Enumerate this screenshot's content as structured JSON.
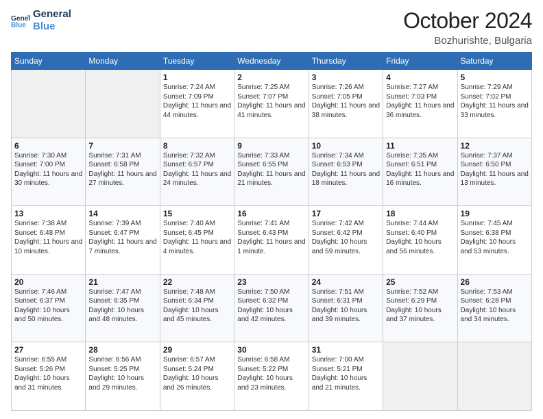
{
  "header": {
    "logo_line1": "General",
    "logo_line2": "Blue",
    "month": "October 2024",
    "location": "Bozhurishte, Bulgaria"
  },
  "weekdays": [
    "Sunday",
    "Monday",
    "Tuesday",
    "Wednesday",
    "Thursday",
    "Friday",
    "Saturday"
  ],
  "weeks": [
    [
      {
        "day": "",
        "empty": true
      },
      {
        "day": "",
        "empty": true
      },
      {
        "day": "1",
        "sunrise": "7:24 AM",
        "sunset": "7:09 PM",
        "daylight": "11 hours and 44 minutes."
      },
      {
        "day": "2",
        "sunrise": "7:25 AM",
        "sunset": "7:07 PM",
        "daylight": "11 hours and 41 minutes."
      },
      {
        "day": "3",
        "sunrise": "7:26 AM",
        "sunset": "7:05 PM",
        "daylight": "11 hours and 38 minutes."
      },
      {
        "day": "4",
        "sunrise": "7:27 AM",
        "sunset": "7:03 PM",
        "daylight": "11 hours and 36 minutes."
      },
      {
        "day": "5",
        "sunrise": "7:29 AM",
        "sunset": "7:02 PM",
        "daylight": "11 hours and 33 minutes."
      }
    ],
    [
      {
        "day": "6",
        "sunrise": "7:30 AM",
        "sunset": "7:00 PM",
        "daylight": "11 hours and 30 minutes."
      },
      {
        "day": "7",
        "sunrise": "7:31 AM",
        "sunset": "6:58 PM",
        "daylight": "11 hours and 27 minutes."
      },
      {
        "day": "8",
        "sunrise": "7:32 AM",
        "sunset": "6:57 PM",
        "daylight": "11 hours and 24 minutes."
      },
      {
        "day": "9",
        "sunrise": "7:33 AM",
        "sunset": "6:55 PM",
        "daylight": "11 hours and 21 minutes."
      },
      {
        "day": "10",
        "sunrise": "7:34 AM",
        "sunset": "6:53 PM",
        "daylight": "11 hours and 18 minutes."
      },
      {
        "day": "11",
        "sunrise": "7:35 AM",
        "sunset": "6:51 PM",
        "daylight": "11 hours and 16 minutes."
      },
      {
        "day": "12",
        "sunrise": "7:37 AM",
        "sunset": "6:50 PM",
        "daylight": "11 hours and 13 minutes."
      }
    ],
    [
      {
        "day": "13",
        "sunrise": "7:38 AM",
        "sunset": "6:48 PM",
        "daylight": "11 hours and 10 minutes."
      },
      {
        "day": "14",
        "sunrise": "7:39 AM",
        "sunset": "6:47 PM",
        "daylight": "11 hours and 7 minutes."
      },
      {
        "day": "15",
        "sunrise": "7:40 AM",
        "sunset": "6:45 PM",
        "daylight": "11 hours and 4 minutes."
      },
      {
        "day": "16",
        "sunrise": "7:41 AM",
        "sunset": "6:43 PM",
        "daylight": "11 hours and 1 minute."
      },
      {
        "day": "17",
        "sunrise": "7:42 AM",
        "sunset": "6:42 PM",
        "daylight": "10 hours and 59 minutes."
      },
      {
        "day": "18",
        "sunrise": "7:44 AM",
        "sunset": "6:40 PM",
        "daylight": "10 hours and 56 minutes."
      },
      {
        "day": "19",
        "sunrise": "7:45 AM",
        "sunset": "6:38 PM",
        "daylight": "10 hours and 53 minutes."
      }
    ],
    [
      {
        "day": "20",
        "sunrise": "7:46 AM",
        "sunset": "6:37 PM",
        "daylight": "10 hours and 50 minutes."
      },
      {
        "day": "21",
        "sunrise": "7:47 AM",
        "sunset": "6:35 PM",
        "daylight": "10 hours and 48 minutes."
      },
      {
        "day": "22",
        "sunrise": "7:48 AM",
        "sunset": "6:34 PM",
        "daylight": "10 hours and 45 minutes."
      },
      {
        "day": "23",
        "sunrise": "7:50 AM",
        "sunset": "6:32 PM",
        "daylight": "10 hours and 42 minutes."
      },
      {
        "day": "24",
        "sunrise": "7:51 AM",
        "sunset": "6:31 PM",
        "daylight": "10 hours and 39 minutes."
      },
      {
        "day": "25",
        "sunrise": "7:52 AM",
        "sunset": "6:29 PM",
        "daylight": "10 hours and 37 minutes."
      },
      {
        "day": "26",
        "sunrise": "7:53 AM",
        "sunset": "6:28 PM",
        "daylight": "10 hours and 34 minutes."
      }
    ],
    [
      {
        "day": "27",
        "sunrise": "6:55 AM",
        "sunset": "5:26 PM",
        "daylight": "10 hours and 31 minutes."
      },
      {
        "day": "28",
        "sunrise": "6:56 AM",
        "sunset": "5:25 PM",
        "daylight": "10 hours and 29 minutes."
      },
      {
        "day": "29",
        "sunrise": "6:57 AM",
        "sunset": "5:24 PM",
        "daylight": "10 hours and 26 minutes."
      },
      {
        "day": "30",
        "sunrise": "6:58 AM",
        "sunset": "5:22 PM",
        "daylight": "10 hours and 23 minutes."
      },
      {
        "day": "31",
        "sunrise": "7:00 AM",
        "sunset": "5:21 PM",
        "daylight": "10 hours and 21 minutes."
      },
      {
        "day": "",
        "empty": true
      },
      {
        "day": "",
        "empty": true
      }
    ]
  ]
}
